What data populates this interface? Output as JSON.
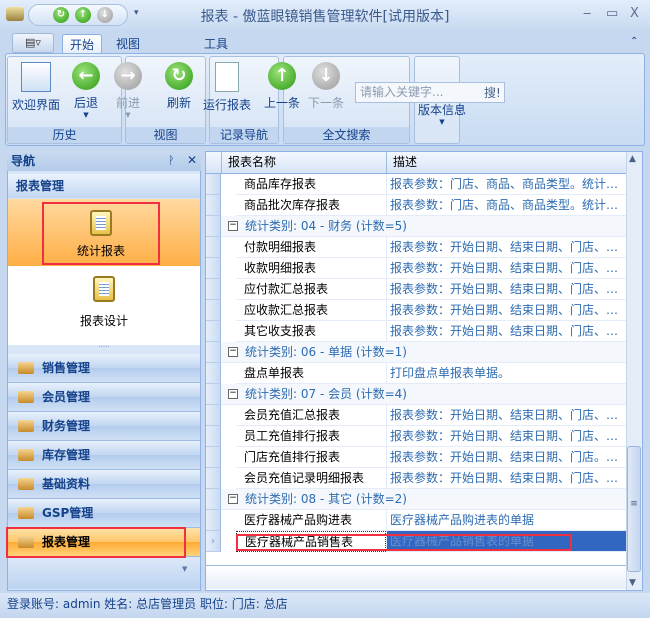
{
  "window": {
    "title": "报表 - 傲蓝眼镜销售管理软件[试用版本]",
    "minimize": "‒",
    "maximize": "▭",
    "close": "X"
  },
  "ribbon": {
    "tabs": [
      {
        "label": "开始",
        "active": true
      },
      {
        "label": "视图"
      },
      {
        "label": "工具"
      }
    ],
    "groups": {
      "history": "历史",
      "view": "视图",
      "record_nav": "记录导航",
      "search": "全文搜索"
    },
    "buttons": {
      "welcome": "欢迎界面",
      "back": "后退",
      "forward": "前进",
      "refresh": "刷新",
      "run_report": "运行报表",
      "prev": "上一条",
      "next": "下一条",
      "version": "版本信息"
    },
    "search": {
      "placeholder": "请输入关键字...",
      "button": "搜!"
    }
  },
  "nav": {
    "title": "导航",
    "pin": "ᚹ",
    "close": "✕",
    "section": "报表管理",
    "items": [
      {
        "label": "统计报表",
        "active": true
      },
      {
        "label": "报表设计"
      }
    ],
    "modules": [
      {
        "label": "销售管理"
      },
      {
        "label": "会员管理"
      },
      {
        "label": "财务管理"
      },
      {
        "label": "库存管理"
      },
      {
        "label": "基础资料"
      },
      {
        "label": "GSP管理"
      },
      {
        "label": "报表管理",
        "active": true
      }
    ]
  },
  "grid": {
    "columns": [
      "报表名称",
      "描述"
    ],
    "rows": [
      {
        "name": "商品库存报表",
        "desc": "报表参数：门店、商品、商品类型。统计…"
      },
      {
        "name": "商品批次库存报表",
        "desc": "报表参数：门店、商品、商品类型。统计…"
      },
      {
        "group": "统计类别: 04 - 财务 (计数=5)"
      },
      {
        "name": "付款明细报表",
        "desc": "报表参数：开始日期、结束日期、门店、…"
      },
      {
        "name": "收款明细报表",
        "desc": "报表参数：开始日期、结束日期、门店、…"
      },
      {
        "name": "应付款汇总报表",
        "desc": "报表参数：开始日期、结束日期、门店、…"
      },
      {
        "name": "应收款汇总报表",
        "desc": "报表参数：开始日期、结束日期、门店、…"
      },
      {
        "name": "其它收支报表",
        "desc": "报表参数：开始日期、结束日期、门店、…"
      },
      {
        "group": "统计类别: 06 - 单据 (计数=1)"
      },
      {
        "name": "盘点单报表",
        "desc": "打印盘点单报表单据。"
      },
      {
        "group": "统计类别: 07 - 会员 (计数=4)"
      },
      {
        "name": "会员充值汇总报表",
        "desc": "报表参数：开始日期、结束日期、门店、…"
      },
      {
        "name": "员工充值排行报表",
        "desc": "报表参数：开始日期、结束日期、门店、…"
      },
      {
        "name": "门店充值排行报表",
        "desc": "报表参数：开始日期、结束日期、门店。…"
      },
      {
        "name": "会员充值记录明细报表",
        "desc": "报表参数：开始日期、结束日期、门店、…"
      },
      {
        "group": "统计类别: 08 - 其它 (计数=2)"
      },
      {
        "name": "医疗器械产品购进表",
        "desc": "医疗器械产品购进表的单据"
      },
      {
        "name": "医疗器械产品销售表",
        "desc": "医疗器械产品销售表的单据",
        "selected": true
      }
    ]
  },
  "status": {
    "text": "登录账号: admin  姓名: 总店管理员  职位:   门店: 总店"
  },
  "colors": {
    "accent": "#15428b",
    "selection": "#3166c1",
    "highlight": "#f03040",
    "active_orange": "#ffaa33"
  }
}
